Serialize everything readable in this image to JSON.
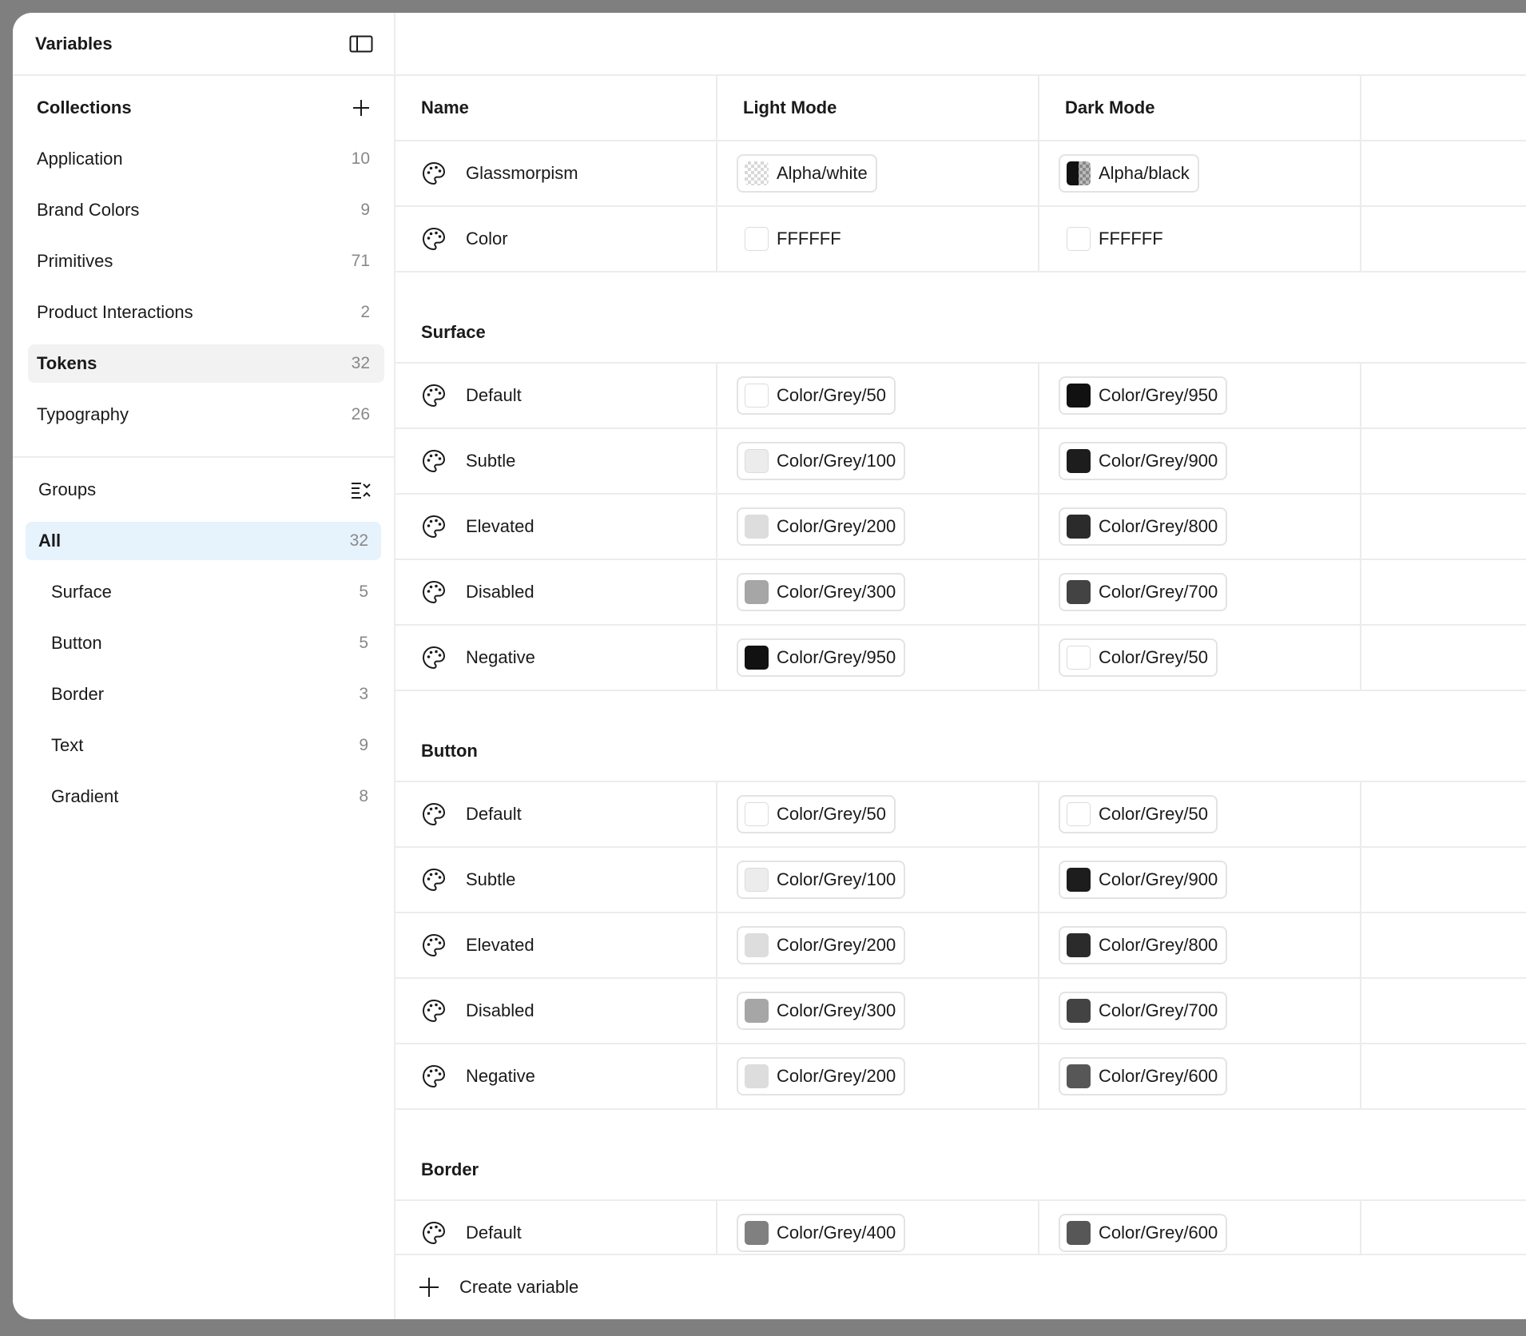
{
  "sidebar": {
    "title": "Variables",
    "collections": {
      "title": "Collections",
      "items": [
        {
          "label": "Application",
          "count": "10"
        },
        {
          "label": "Brand Colors",
          "count": "9"
        },
        {
          "label": "Primitives",
          "count": "71"
        },
        {
          "label": "Product Interactions",
          "count": "2"
        },
        {
          "label": "Tokens",
          "count": "32"
        },
        {
          "label": "Typography",
          "count": "26"
        }
      ]
    },
    "groups": {
      "title": "Groups",
      "items": [
        {
          "label": "All",
          "count": "32"
        },
        {
          "label": "Surface",
          "count": "5"
        },
        {
          "label": "Button",
          "count": "5"
        },
        {
          "label": "Border",
          "count": "3"
        },
        {
          "label": "Text",
          "count": "9"
        },
        {
          "label": "Gradient",
          "count": "8"
        }
      ]
    }
  },
  "table": {
    "columns": {
      "name": "Name",
      "light": "Light Mode",
      "dark": "Dark Mode"
    },
    "ungrouped": [
      {
        "name": "Glassmorpism",
        "light": "Alpha/white",
        "dark": "Alpha/black"
      },
      {
        "name": "Color",
        "light": "FFFFFF",
        "dark": "FFFFFF"
      }
    ],
    "groups": [
      {
        "title": "Surface",
        "rows": [
          {
            "name": "Default",
            "light": "Color/Grey/50",
            "dark": "Color/Grey/950"
          },
          {
            "name": "Subtle",
            "light": "Color/Grey/100",
            "dark": "Color/Grey/900"
          },
          {
            "name": "Elevated",
            "light": "Color/Grey/200",
            "dark": "Color/Grey/800"
          },
          {
            "name": "Disabled",
            "light": "Color/Grey/300",
            "dark": "Color/Grey/700"
          },
          {
            "name": "Negative",
            "light": "Color/Grey/950",
            "dark": "Color/Grey/50"
          }
        ]
      },
      {
        "title": "Button",
        "rows": [
          {
            "name": "Default",
            "light": "Color/Grey/50",
            "dark": "Color/Grey/50"
          },
          {
            "name": "Subtle",
            "light": "Color/Grey/100",
            "dark": "Color/Grey/900"
          },
          {
            "name": "Elevated",
            "light": "Color/Grey/200",
            "dark": "Color/Grey/800"
          },
          {
            "name": "Disabled",
            "light": "Color/Grey/300",
            "dark": "Color/Grey/700"
          },
          {
            "name": "Negative",
            "light": "Color/Grey/200",
            "dark": "Color/Grey/600"
          }
        ]
      },
      {
        "title": "Border",
        "rows": [
          {
            "name": "Default",
            "light": "Color/Grey/400",
            "dark": "Color/Grey/600"
          }
        ]
      }
    ]
  },
  "footer": {
    "create_label": "Create variable"
  },
  "colors": {
    "grey_50": "#ffffff",
    "grey_100": "#ececec",
    "grey_200": "#dddddd",
    "grey_300": "#a6a6a6",
    "grey_400": "#808080",
    "grey_600": "#575757",
    "grey_700": "#434343",
    "grey_800": "#2b2b2b",
    "grey_900": "#1d1d1d",
    "grey_950": "#111111",
    "selected_bg": "#f2f2f2",
    "active_bg": "#e6f2fc"
  },
  "icons": {
    "sidebar_toggle": "panel-layout-icon",
    "add": "plus-icon",
    "groups_sort": "list-sort-icon",
    "variable": "palette-icon"
  }
}
